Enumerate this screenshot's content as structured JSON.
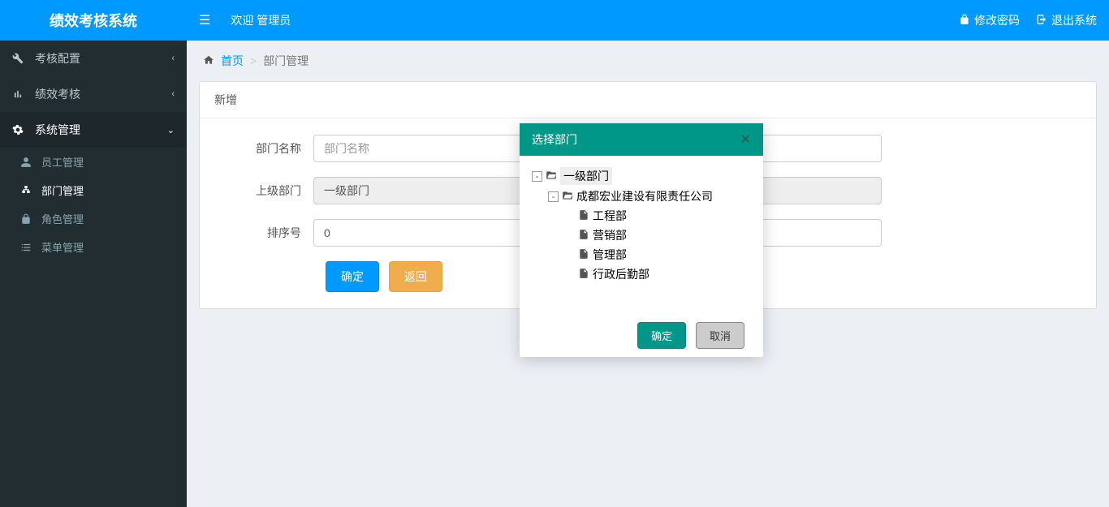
{
  "app_title": "绩效考核系统",
  "topbar": {
    "welcome": "欢迎 管理员",
    "change_password": "修改密码",
    "logout": "退出系统"
  },
  "sidebar": {
    "items": [
      {
        "label": "考核配置",
        "icon": "wrench",
        "expandable": true
      },
      {
        "label": "绩效考核",
        "icon": "chart",
        "expandable": true
      },
      {
        "label": "系统管理",
        "icon": "gear",
        "expandable": true,
        "expanded": true
      }
    ],
    "sub_items": [
      {
        "label": "员工管理",
        "icon": "user"
      },
      {
        "label": "部门管理",
        "icon": "sitemap",
        "active": true
      },
      {
        "label": "角色管理",
        "icon": "lock"
      },
      {
        "label": "菜单管理",
        "icon": "list"
      }
    ]
  },
  "breadcrumb": {
    "home": "首页",
    "current": "部门管理"
  },
  "panel": {
    "title": "新增"
  },
  "form": {
    "dept_name_label": "部门名称",
    "dept_name_placeholder": "部门名称",
    "parent_dept_label": "上级部门",
    "parent_dept_value": "一级部门",
    "sort_label": "排序号",
    "sort_value": "0",
    "submit": "确定",
    "back": "返回"
  },
  "modal": {
    "title": "选择部门",
    "ok": "确定",
    "cancel": "取消",
    "tree": {
      "root": "一级部门",
      "company": "成都宏业建设有限责任公司",
      "leaves": [
        "工程部",
        "营销部",
        "管理部",
        "行政后勤部"
      ]
    }
  }
}
